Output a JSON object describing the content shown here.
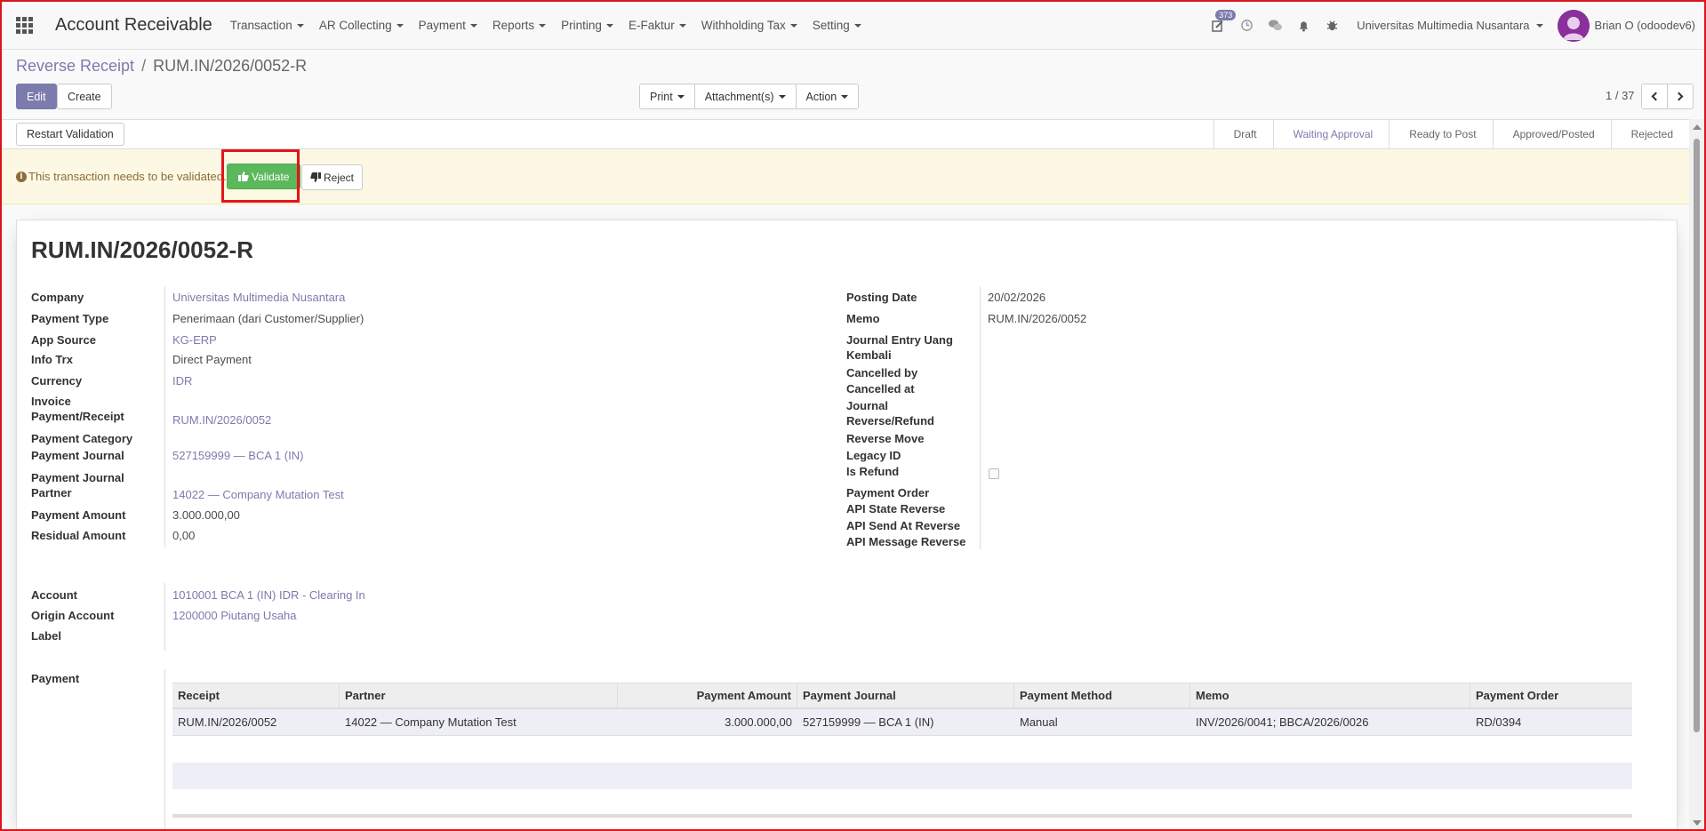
{
  "app": {
    "title": "Account Receivable",
    "menu": [
      "Transaction",
      "AR Collecting",
      "Payment",
      "Reports",
      "Printing",
      "E-Faktur",
      "Withholding Tax",
      "Setting"
    ],
    "activity_badge": "373",
    "company": "Universitas Multimedia Nusantara",
    "user": "Brian O (odoodev6)"
  },
  "breadcrumb": {
    "parent": "Reverse Receipt",
    "separator": "/",
    "current": "RUM.IN/2026/0052-R"
  },
  "toolbar": {
    "edit": "Edit",
    "create": "Create",
    "print": "Print",
    "attachments": "Attachment(s)",
    "action": "Action",
    "pager": "1 / 37"
  },
  "statusbar": {
    "restart": "Restart Validation",
    "stages": [
      "Draft",
      "Waiting Approval",
      "Ready to Post",
      "Approved/Posted",
      "Rejected"
    ],
    "active_stage": "Waiting Approval"
  },
  "alert": {
    "message": "This transaction needs to be validated.",
    "validate": "Validate",
    "reject": "Reject"
  },
  "record": {
    "title": "RUM.IN/2026/0052-R",
    "left_fields": [
      {
        "label": "Company",
        "value": "Universitas Multimedia Nusantara"
      },
      {
        "label": "Payment Type",
        "value": "Penerimaan (dari Customer/Supplier)"
      },
      {
        "label": "App Source",
        "value": "KG-ERP"
      },
      {
        "label": "Info Trx",
        "value": "Direct Payment"
      },
      {
        "label": "Currency",
        "value": "IDR"
      },
      {
        "label": "Invoice Payment/Receipt",
        "value": "RUM.IN/2026/0052"
      },
      {
        "label": "Payment Category",
        "value": ""
      },
      {
        "label": "Payment Journal",
        "value": "527159999 — BCA 1 (IN)"
      },
      {
        "label": "Payment Journal Partner",
        "value": "14022 — Company Mutation Test"
      },
      {
        "label": "Payment Amount",
        "value": "3.000.000,00"
      },
      {
        "label": "Residual Amount",
        "value": "0,00"
      }
    ],
    "right_fields": [
      {
        "label": "Posting Date",
        "value": "20/02/2026"
      },
      {
        "label": "Memo",
        "value": "RUM.IN/2026/0052"
      },
      {
        "label": "Journal Entry Uang Kembali",
        "value": ""
      },
      {
        "label": "Cancelled by",
        "value": ""
      },
      {
        "label": "Cancelled at",
        "value": ""
      },
      {
        "label": "Journal Reverse/Refund",
        "value": ""
      },
      {
        "label": "Reverse Move",
        "value": ""
      },
      {
        "label": "Legacy ID",
        "value": ""
      },
      {
        "label": "Is Refund",
        "value": ""
      },
      {
        "label": "Payment Order",
        "value": ""
      },
      {
        "label": "API State Reverse",
        "value": ""
      },
      {
        "label": "API Send At Reverse",
        "value": ""
      },
      {
        "label": "API Message Reverse",
        "value": ""
      }
    ],
    "account_fields": [
      {
        "label": "Account",
        "value": "1010001 BCA 1 (IN) IDR - Clearing In"
      },
      {
        "label": "Origin Account",
        "value": "1200000 Piutang Usaha"
      },
      {
        "label": "Label",
        "value": ""
      }
    ],
    "payment_label": "Payment",
    "payment_table": {
      "columns": [
        "Receipt",
        "Partner",
        "Payment Amount",
        "Payment Journal",
        "Payment Method",
        "Memo",
        "Payment Order"
      ],
      "rows": [
        [
          "RUM.IN/2026/0052",
          "14022 — Company Mutation Test",
          "3.000.000,00",
          "527159999 — BCA 1 (IN)",
          "Manual",
          "INV/2026/0041; BBCA/2026/0026",
          "RD/0394"
        ]
      ]
    }
  }
}
